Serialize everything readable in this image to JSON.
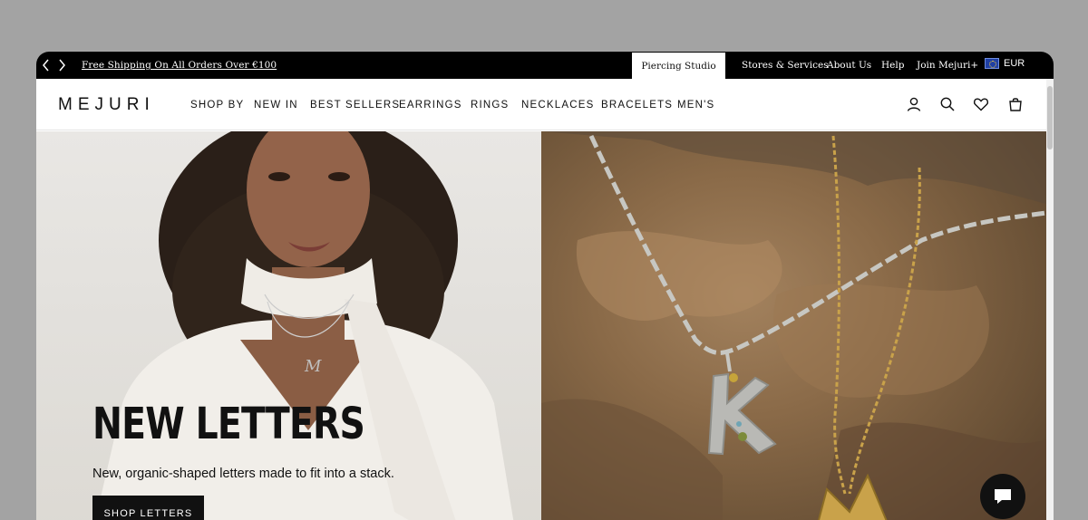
{
  "topbar": {
    "prev_icon": "chevron-left-icon",
    "next_icon": "chevron-right-icon",
    "promo": "Free Shipping On All Orders Over €100",
    "piercing_tab": "Piercing Studio",
    "links": [
      {
        "label": "Stores & Services"
      },
      {
        "label": "About Us"
      },
      {
        "label": "Help"
      },
      {
        "label": "Join Mejuri+"
      }
    ],
    "currency": "EUR",
    "currency_icon": "eu-flag-icon"
  },
  "nav": {
    "logo": "MEJURI",
    "items": [
      {
        "label": "SHOP BY"
      },
      {
        "label": "NEW IN"
      },
      {
        "label": "BEST SELLERS"
      },
      {
        "label": "EARRINGS"
      },
      {
        "label": "RINGS"
      },
      {
        "label": "NECKLACES"
      },
      {
        "label": "BRACELETS"
      },
      {
        "label": "MEN'S"
      }
    ],
    "icons": [
      "account-icon",
      "search-icon",
      "wishlist-heart-icon",
      "shopping-bag-icon"
    ]
  },
  "hero": {
    "title": "NEW LETTERS",
    "subtitle": "New, organic-shaped letters made to fit into a stack.",
    "cta": "SHOP LETTERS"
  },
  "chat": {
    "icon": "chat-bubble-icon"
  },
  "colors": {
    "backdrop": "#a3a3a3",
    "topbar": "#000000",
    "text": "#111111",
    "accent_gold": "#c9a24a",
    "stone": "#8a6a48"
  }
}
